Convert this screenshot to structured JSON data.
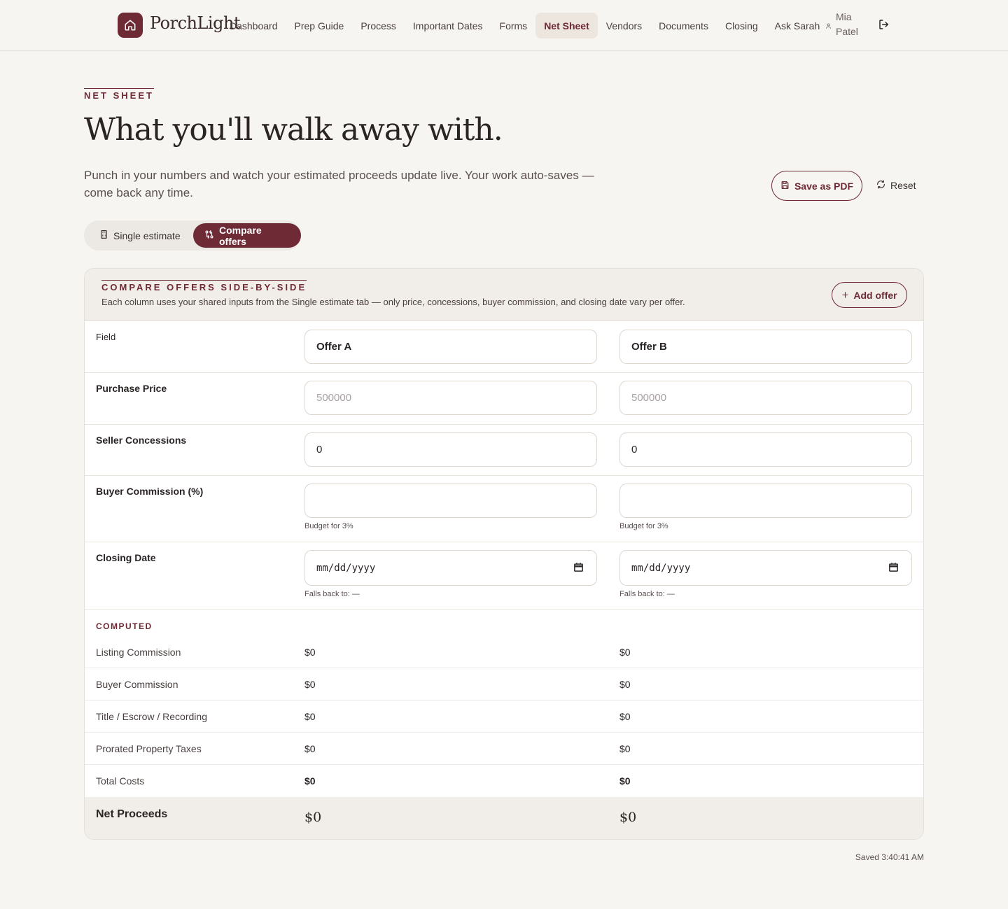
{
  "brand": {
    "name": "PorchLight",
    "logo_icon": "home-icon"
  },
  "nav": {
    "items": [
      {
        "label": "Dashboard"
      },
      {
        "label": "Prep Guide"
      },
      {
        "label": "Process"
      },
      {
        "label": "Important Dates"
      },
      {
        "label": "Forms"
      },
      {
        "label": "Net Sheet",
        "active": true
      },
      {
        "label": "Vendors"
      },
      {
        "label": "Documents"
      },
      {
        "label": "Closing"
      },
      {
        "label": "Ask Sarah"
      }
    ],
    "user": {
      "name": "Mia Patel",
      "icon": "user-icon"
    },
    "logout_icon": "logout-icon"
  },
  "page": {
    "eyebrow": "NET SHEET",
    "title": "What you'll walk away with.",
    "lead": "Punch in your numbers and watch your estimated proceeds update live. Your work auto-saves — come back any time.",
    "save_pdf_label": "Save as PDF",
    "reset_label": "Reset"
  },
  "tabs": {
    "single": "Single estimate",
    "compare": "Compare offers",
    "active": "compare"
  },
  "compare": {
    "title": "COMPARE OFFERS SIDE-BY-SIDE",
    "subtitle": "Each column uses your shared inputs from the Single estimate tab — only price, concessions, buyer commission, and closing date vary per offer.",
    "add_offer_label": "Add offer",
    "field_header": "Field",
    "offers": [
      {
        "name": "Offer A",
        "purchase_price_placeholder": "500000",
        "seller_concessions": "0",
        "buyer_commission": "",
        "buyer_commission_hint": "Budget for 3%",
        "closing_date_placeholder": "mm/dd/yyyy",
        "closing_date_hint": "Falls back to: —",
        "listing_commission": "$0",
        "buyer_commission_cost": "$0",
        "title_escrow": "$0",
        "prorated_taxes": "$0",
        "total_costs": "$0",
        "net_proceeds": "$0"
      },
      {
        "name": "Offer B",
        "purchase_price_placeholder": "500000",
        "seller_concessions": "0",
        "buyer_commission": "",
        "buyer_commission_hint": "Budget for 3%",
        "closing_date_placeholder": "mm/dd/yyyy",
        "closing_date_hint": "Falls back to: —",
        "listing_commission": "$0",
        "buyer_commission_cost": "$0",
        "title_escrow": "$0",
        "prorated_taxes": "$0",
        "total_costs": "$0",
        "net_proceeds": "$0"
      }
    ],
    "labels": {
      "purchase_price": "Purchase Price",
      "seller_concessions": "Seller Concessions",
      "buyer_commission_pct": "Buyer Commission (%)",
      "closing_date": "Closing Date",
      "computed": "COMPUTED",
      "listing_commission": "Listing Commission",
      "buyer_commission": "Buyer Commission",
      "title_escrow": "Title / Escrow / Recording",
      "prorated_taxes": "Prorated Property Taxes",
      "total_costs": "Total Costs",
      "net_proceeds": "Net Proceeds"
    }
  },
  "status": {
    "saved": "Saved 3:40:41 AM"
  },
  "colors": {
    "accent": "#6e2a35",
    "background": "#f7f5f1",
    "panel": "#f1ede8"
  }
}
